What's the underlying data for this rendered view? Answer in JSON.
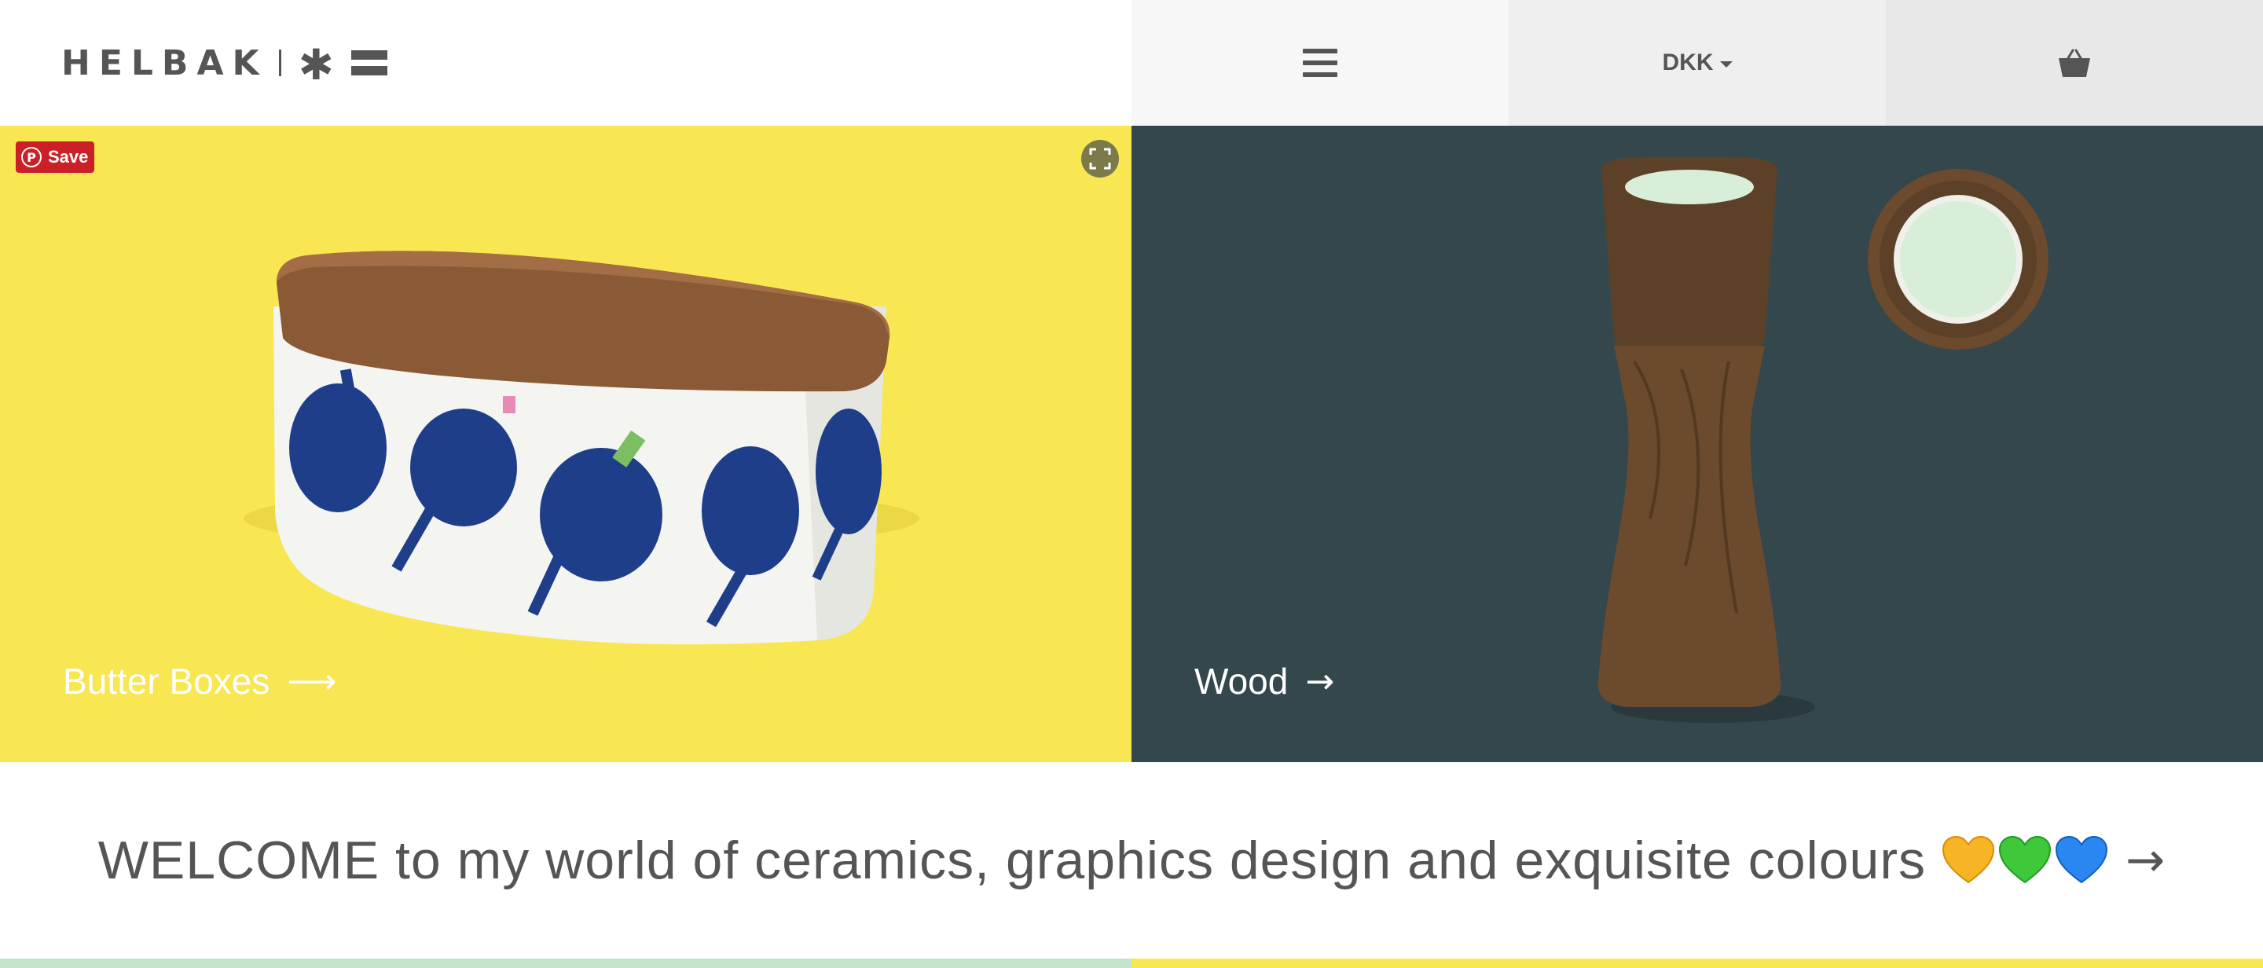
{
  "header": {
    "logo": {
      "word": "HELBAK",
      "asterisk": "✱"
    },
    "menu_icon": "hamburger-menu-icon",
    "currency": {
      "label": "DKK"
    },
    "cart_icon": "shopping-basket-icon"
  },
  "hero": {
    "left": {
      "label": "Butter Boxes",
      "arrow": "⟶",
      "background": "#f8e652"
    },
    "right": {
      "label": "Wood",
      "arrow": "→",
      "background": "#34474c"
    }
  },
  "pinterest": {
    "save_label": "Save",
    "icon": "pinterest-icon",
    "color": "#cb2027"
  },
  "expand_icon": "expand-image-icon",
  "welcome": {
    "text": "WELCOME to my world of ceramics, graphics design and exquisite colours",
    "hearts": [
      "yellow-heart-icon",
      "green-heart-icon",
      "blue-heart-icon"
    ],
    "arrow": "→"
  },
  "colors": {
    "text": "#555555",
    "yellow": "#f8e652",
    "teal": "#34474c",
    "mint": "#c4e4cc"
  }
}
